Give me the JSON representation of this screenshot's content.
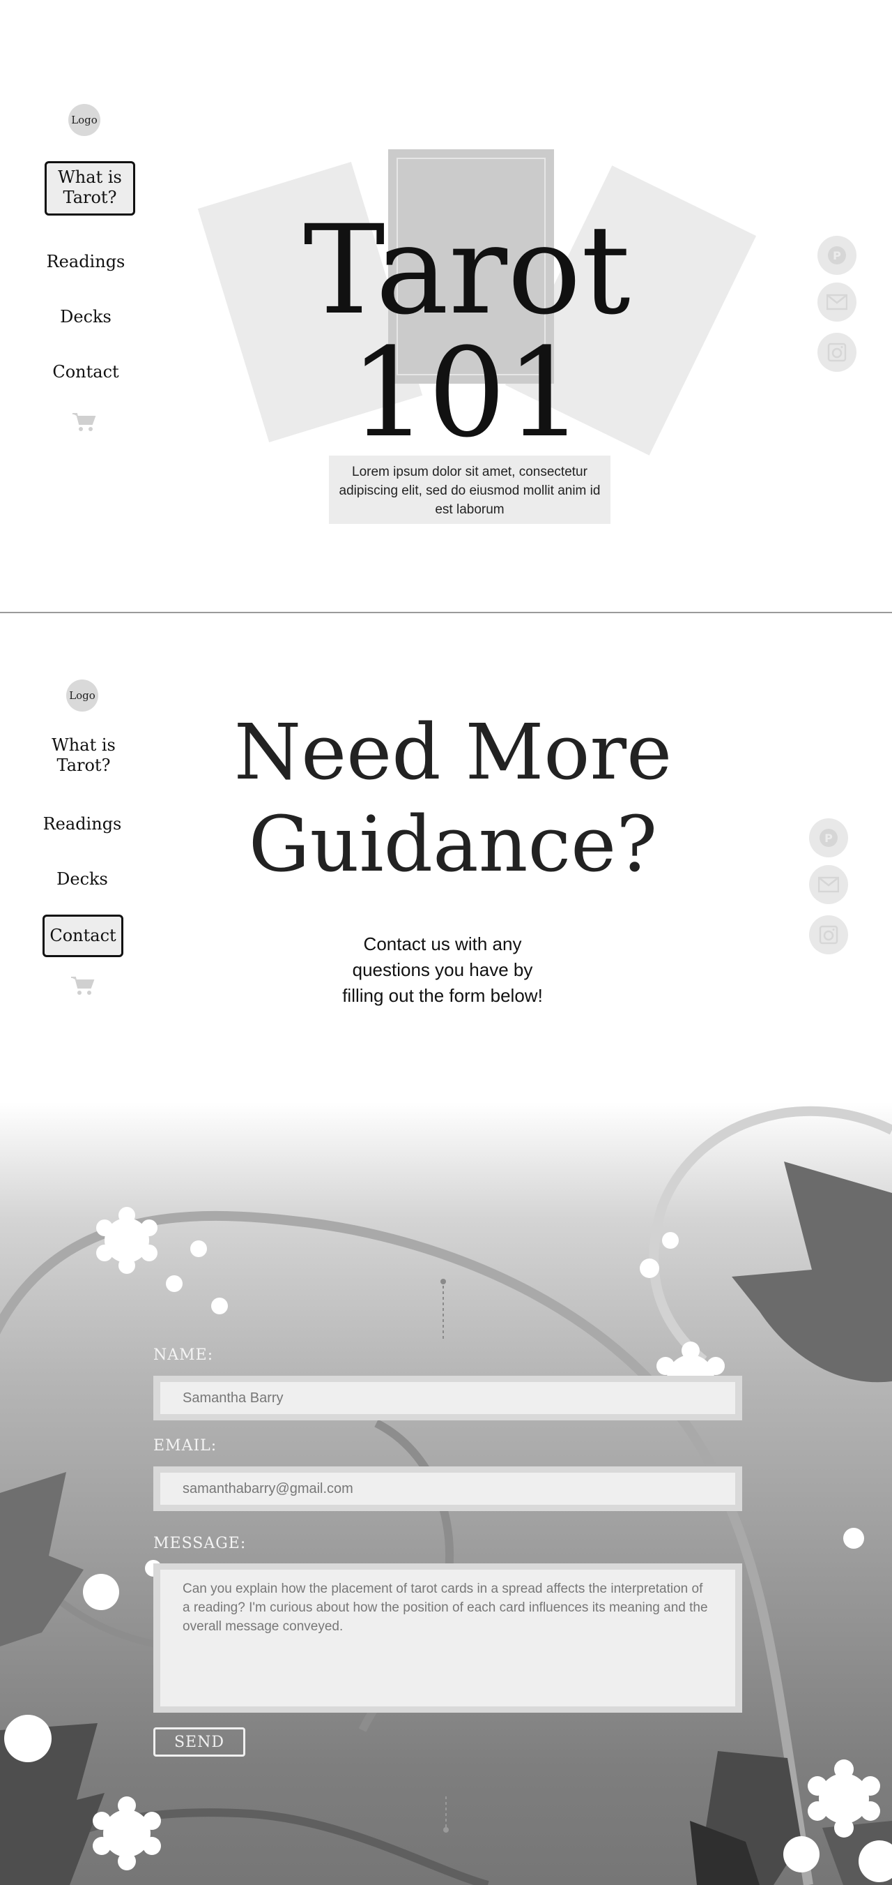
{
  "brand": {
    "logo_text": "Logo"
  },
  "nav": {
    "items": [
      {
        "label_line1": "What is",
        "label_line2": "Tarot?"
      },
      {
        "label": "Readings"
      },
      {
        "label": "Decks"
      },
      {
        "label": "Contact"
      }
    ],
    "cart_icon": "cart-icon"
  },
  "social": {
    "icons": [
      "pinterest-icon",
      "mail-icon",
      "instagram-icon"
    ]
  },
  "hero": {
    "title": "Tarot 101",
    "description": "Lorem ipsum dolor sit amet, consectetur adipiscing elit, sed do eiusmod mollit anim id est laborum"
  },
  "contact": {
    "title_line1": "Need More",
    "title_line2": "Guidance?",
    "description": "Contact us with any questions you have by filling out the form below!"
  },
  "form": {
    "name_label": "NAME:",
    "name_value": "Samantha Barry",
    "email_label": "EMAIL:",
    "email_value": "samanthabarry@gmail.com",
    "message_label": "MESSAGE:",
    "message_value": "Can you explain how the placement of tarot cards in a spread affects the interpretation of a reading? I'm curious about how the position of each card influences its meaning and the overall message conveyed.",
    "send_label": "SEND"
  },
  "colors": {
    "active_nav_border": "#111111",
    "card_light": "#ebebeb",
    "card_dark": "#cbcbcb",
    "leaf_dark": "#6b6b6b"
  }
}
